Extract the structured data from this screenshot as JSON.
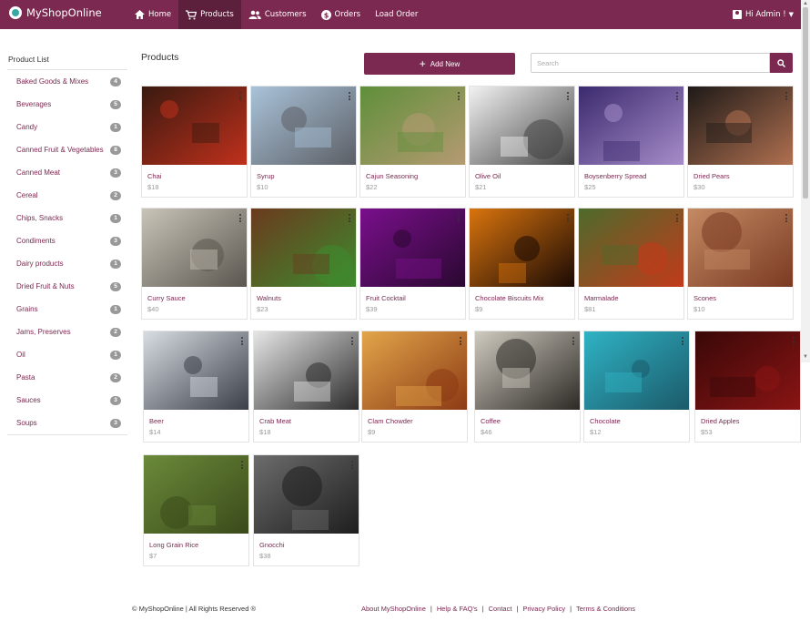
{
  "brand": {
    "name": "MyShopOnline"
  },
  "nav": {
    "home": "Home",
    "products": "Products",
    "customers": "Customers",
    "orders": "Orders",
    "load_order": "Load Order"
  },
  "user": {
    "greeting": "Hi Admin !"
  },
  "sidebar": {
    "title": "Product List",
    "items": [
      {
        "label": "Baked Goods & Mixes",
        "count": "4"
      },
      {
        "label": "Beverages",
        "count": "5"
      },
      {
        "label": "Candy",
        "count": "1"
      },
      {
        "label": "Canned Fruit & Vegetables",
        "count": "8"
      },
      {
        "label": "Canned Meat",
        "count": "3"
      },
      {
        "label": "Cereal",
        "count": "2"
      },
      {
        "label": "Chips, Snacks",
        "count": "1"
      },
      {
        "label": "Condiments",
        "count": "3"
      },
      {
        "label": "Dairy products",
        "count": "1"
      },
      {
        "label": "Dried Fruit & Nuts",
        "count": "5"
      },
      {
        "label": "Grains",
        "count": "1"
      },
      {
        "label": "Jams, Preserves",
        "count": "2"
      },
      {
        "label": "Oil",
        "count": "1"
      },
      {
        "label": "Pasta",
        "count": "2"
      },
      {
        "label": "Sauces",
        "count": "3"
      },
      {
        "label": "Soups",
        "count": "3"
      }
    ]
  },
  "main": {
    "title": "Products",
    "add_new": "Add New",
    "search_placeholder": "Search"
  },
  "products": [
    {
      "name": "Chai",
      "price": "$18",
      "c1": "#3a1a10",
      "c2": "#c0301c"
    },
    {
      "name": "Syrup",
      "price": "$10",
      "c1": "#a9c3d9",
      "c2": "#5c5f66"
    },
    {
      "name": "Cajun Seasoning",
      "price": "$22",
      "c1": "#5f8f3a",
      "c2": "#b59a72"
    },
    {
      "name": "Olive Oil",
      "price": "$21",
      "c1": "#f2f2f2",
      "c2": "#444444"
    },
    {
      "name": "Boysenberry Spread",
      "price": "$25",
      "c1": "#3b2a6e",
      "c2": "#a68cc9"
    },
    {
      "name": "Dried Pears",
      "price": "$30",
      "c1": "#1e1a18",
      "c2": "#b07050"
    },
    {
      "name": "Curry Sauce",
      "price": "$40",
      "c1": "#c9c4b8",
      "c2": "#5a564f"
    },
    {
      "name": "Walnuts",
      "price": "$23",
      "c1": "#6b3a1e",
      "c2": "#3e8b2e"
    },
    {
      "name": "Fruit Cocktail",
      "price": "$39",
      "c1": "#7a0f8c",
      "c2": "#2a0830"
    },
    {
      "name": "Chocolate Biscuits Mix",
      "price": "$9",
      "c1": "#d9740e",
      "c2": "#1a0a04"
    },
    {
      "name": "Marmalade",
      "price": "$81",
      "c1": "#4d6b2c",
      "c2": "#c23a1a"
    },
    {
      "name": "Scones",
      "price": "$10",
      "c1": "#c48a63",
      "c2": "#7a3a22"
    },
    {
      "name": "Beer",
      "price": "$14",
      "c1": "#d8dde3",
      "c2": "#3a3f48"
    },
    {
      "name": "Crab Meat",
      "price": "$18",
      "c1": "#e6e6e6",
      "c2": "#2c2c2c"
    },
    {
      "name": "Clam Chowder",
      "price": "$9",
      "c1": "#e2a54a",
      "c2": "#8c3a14"
    },
    {
      "name": "Coffee",
      "price": "$46",
      "c1": "#cfcabf",
      "c2": "#2d2a26"
    },
    {
      "name": "Chocolate",
      "price": "$12",
      "c1": "#2fb3c4",
      "c2": "#1b5a6a"
    },
    {
      "name": "Dried Apples",
      "price": "$53",
      "c1": "#3a0808",
      "c2": "#8a1414"
    },
    {
      "name": "Long Grain Rice",
      "price": "$7",
      "c1": "#6b8a3a",
      "c2": "#3a4a1a"
    },
    {
      "name": "Gnocchi",
      "price": "$38",
      "c1": "#6c6c6c",
      "c2": "#1e1e1e"
    }
  ],
  "footer": {
    "copyright": "© MyShopOnline | All Rights Reserved ®",
    "links": [
      "About MyShopOnline",
      "Help & FAQ's",
      "Contact",
      "Privacy Policy",
      "Terms & Conditions"
    ]
  }
}
